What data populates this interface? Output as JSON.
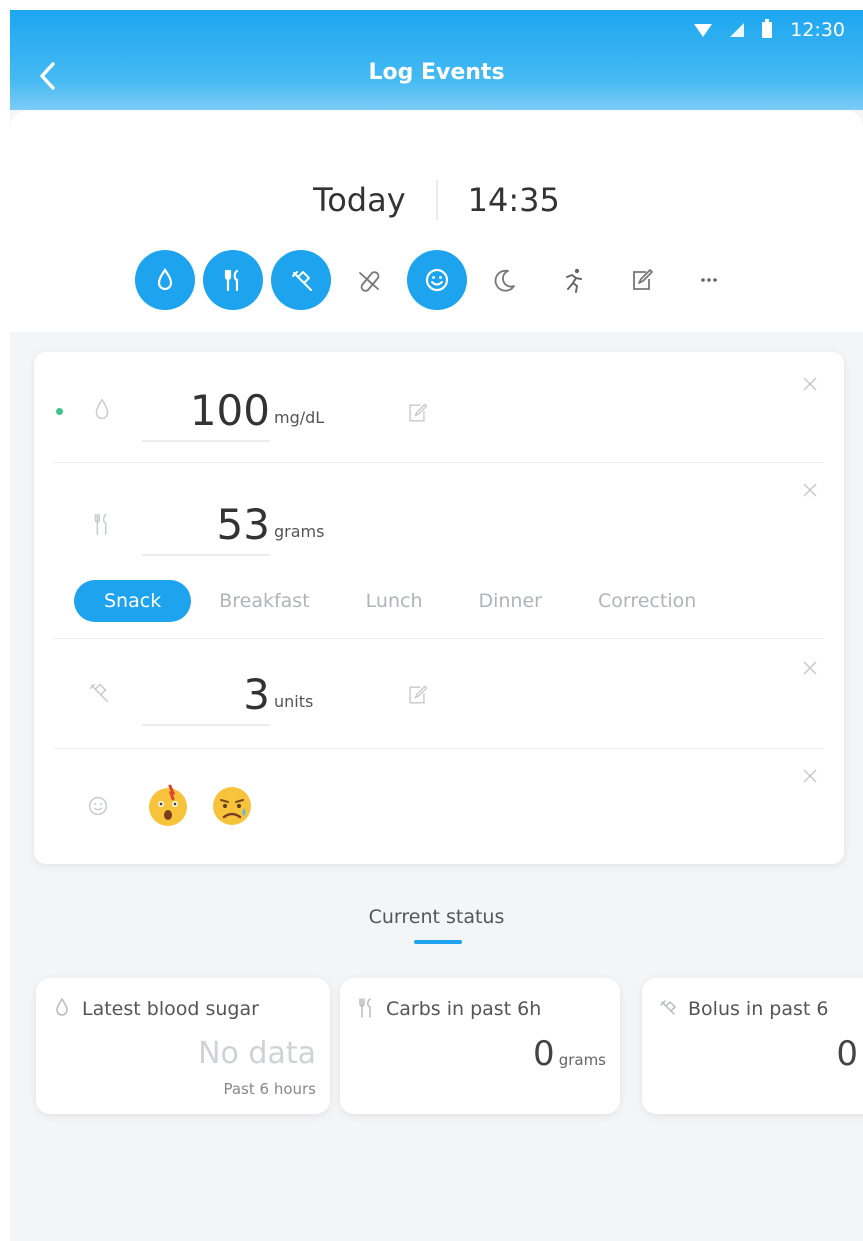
{
  "status_bar": {
    "time": "12:30"
  },
  "header": {
    "title": "Log Events"
  },
  "datetime": {
    "date": "Today",
    "time": "14:35"
  },
  "type_icons": [
    {
      "name": "blood-drop-icon",
      "active": true
    },
    {
      "name": "fork-knife-icon",
      "active": true
    },
    {
      "name": "syringe-icon",
      "active": true
    },
    {
      "name": "pill-icon",
      "active": false
    },
    {
      "name": "smiley-icon",
      "active": true
    },
    {
      "name": "moon-icon",
      "active": false
    },
    {
      "name": "running-icon",
      "active": false
    },
    {
      "name": "note-icon",
      "active": false
    },
    {
      "name": "more-icon",
      "active": false
    }
  ],
  "entries": {
    "glucose": {
      "value": "100",
      "unit": "mg/dL"
    },
    "carbs": {
      "value": "53",
      "unit": "grams"
    },
    "insulin": {
      "value": "3",
      "unit": "units"
    }
  },
  "meal_tabs": [
    "Snack",
    "Breakfast",
    "Lunch",
    "Dinner",
    "Correction"
  ],
  "selected_meal": "Snack",
  "current_status": {
    "title": "Current status",
    "cards": [
      {
        "label": "Latest blood sugar",
        "value": "No data",
        "unit": "",
        "sub": "Past 6 hours"
      },
      {
        "label": "Carbs in past 6h",
        "value": "0",
        "unit": "grams",
        "sub": ""
      },
      {
        "label": "Bolus in past 6",
        "value": "0",
        "unit": "",
        "sub": ""
      }
    ]
  },
  "colors": {
    "accent": "#1ea3ee",
    "header_top": "#1ca6f0",
    "green_dot": "#3fc38d"
  }
}
